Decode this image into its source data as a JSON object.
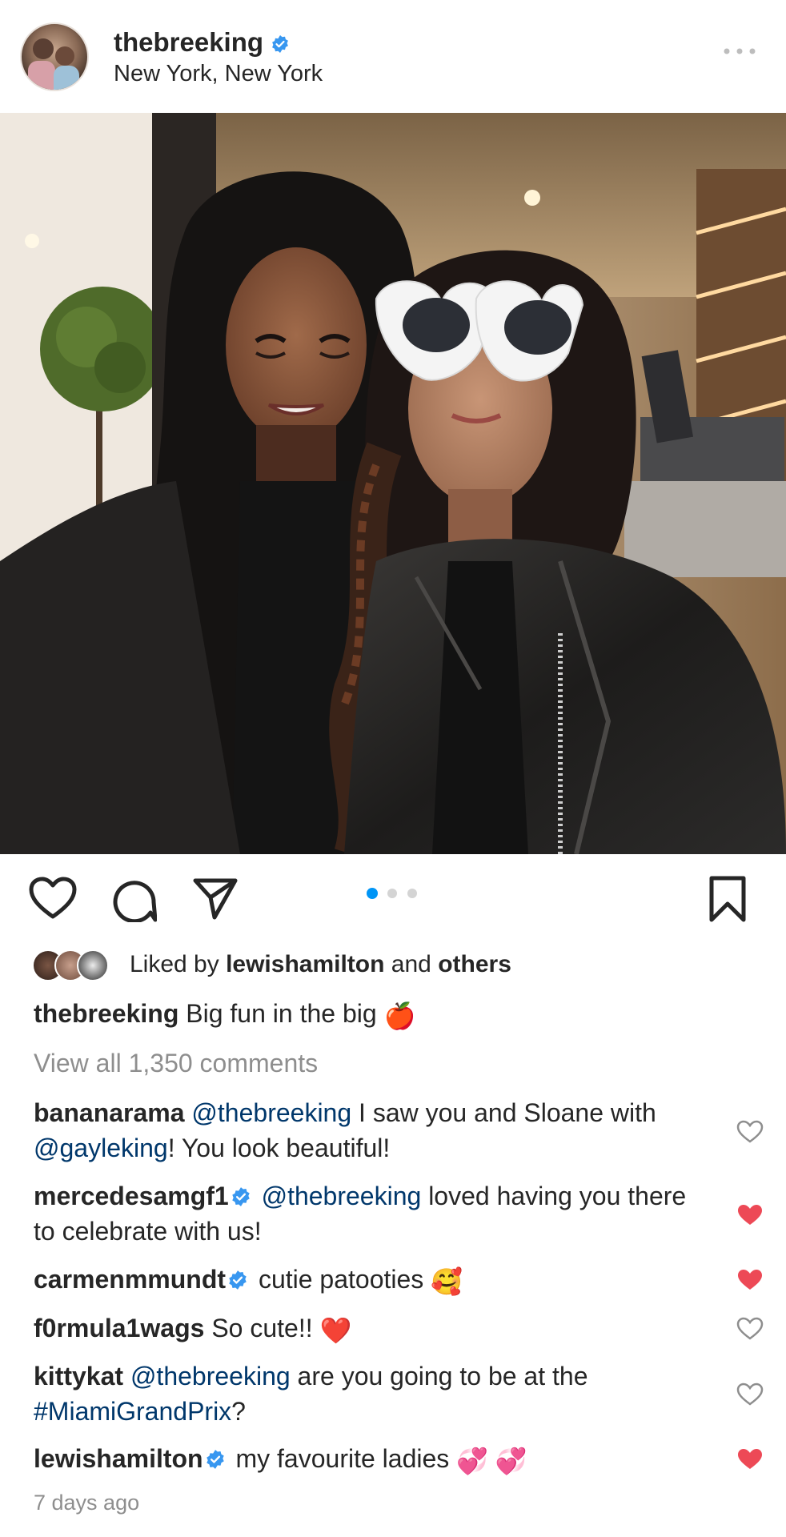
{
  "post": {
    "username": "thebreeking",
    "location": "New York, New York"
  },
  "carousel": {
    "current_index": 1,
    "total": 3
  },
  "likes": {
    "prefix": "Liked by ",
    "user": "lewishamilton",
    "middle": " and ",
    "suffix": "others"
  },
  "caption": {
    "username": "thebreeking",
    "text": " Big fun in the big ",
    "emoji": "🍎"
  },
  "view_all_comments": "View all 1,350 comments",
  "comments": [
    {
      "username": "bananarama",
      "mention": "@thebreeking",
      "text_a": " I saw you and Sloane with ",
      "mention2": "@gayleking",
      "text_b": "! You look beautiful!",
      "liked": false
    },
    {
      "username": "mercedesamgf1",
      "verified": true,
      "mention": "@thebreeking",
      "text_a": " loved having you there to celebrate with us!",
      "liked": true
    },
    {
      "username": "carmenmmundt",
      "verified": true,
      "text_a": " cutie patooties ",
      "emoji": "🥰",
      "liked": true
    },
    {
      "username": "f0rmula1wags",
      "text_a": " So cute!! ",
      "emoji": "❤️",
      "liked": false
    },
    {
      "username": "kittykat",
      "mention": "@thebreeking",
      "text_a": " are you going to be at the ",
      "mention2": "#MiamiGrandPrix",
      "text_b": "?",
      "liked": false
    },
    {
      "username": "lewishamilton",
      "verified": true,
      "text_a": " my favourite ladies ",
      "emoji": "💞 💞",
      "liked": true
    }
  ],
  "timestamp": "7 days ago",
  "colors": {
    "verified_blue": "#3897f0",
    "liked_red": "#ed4956",
    "mention_blue": "#00376b",
    "muted_gray": "#8e8e8e",
    "active_dot": "#0095f6"
  },
  "icons": [
    "verified-badge-icon",
    "more-options-icon",
    "heart-icon",
    "comment-icon",
    "share-icon",
    "bookmark-icon",
    "small-heart-icon",
    "filled-heart-icon"
  ]
}
